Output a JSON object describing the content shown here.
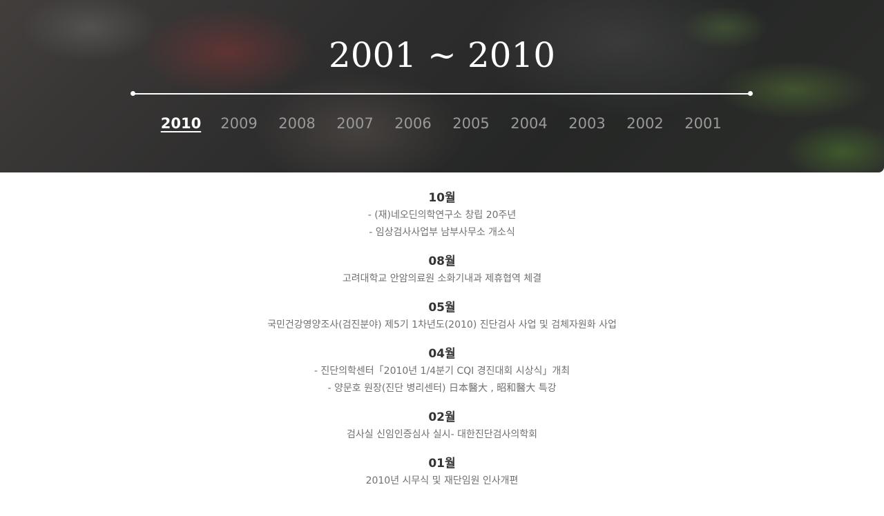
{
  "hero": {
    "title": "2001 ~ 2010",
    "years": [
      "2010",
      "2009",
      "2008",
      "2007",
      "2006",
      "2005",
      "2004",
      "2003",
      "2002",
      "2001"
    ],
    "active_year": "2010"
  },
  "months": [
    {
      "label": "10월",
      "entries": [
        "- (재)네오딘의학연구소 창립 20주년",
        "- 임상검사사업부 남부사무소 개소식"
      ]
    },
    {
      "label": "08월",
      "entries": [
        "고려대학교 안암의료원 소화기내과 제휴협역 체결"
      ]
    },
    {
      "label": "05월",
      "entries": [
        "국민건강영양조사(검진분야) 제5기 1차년도(2010) 진단검사 사업 및 검체자원화 사업"
      ]
    },
    {
      "label": "04월",
      "entries": [
        "- 진단의학센터「2010년 1/4분기 CQI 경진대회 시상식」개최",
        "- 양문호 원장(진단 병리센터) 日本醫大 , 昭和醫大 특강"
      ]
    },
    {
      "label": "02월",
      "entries": [
        "검사실 신임인증심사 실시- 대한진단검사의학회"
      ]
    },
    {
      "label": "01월",
      "entries": [
        "2010년 시무식 및 재단임원 인사개편"
      ]
    }
  ]
}
